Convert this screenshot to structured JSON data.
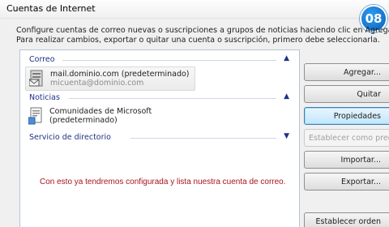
{
  "window": {
    "title": "Cuentas de Internet"
  },
  "badge": {
    "text": "08"
  },
  "instructions": {
    "line1": "Configure cuentas de correo nuevas o suscripciones a grupos de noticias haciendo clic en Agregar.",
    "line2": "Para realizar cambios, exportar o quitar una cuenta o suscripción, primero debe seleccionarla."
  },
  "groups": {
    "mail": {
      "label": "Correo",
      "account": {
        "name": "mail.dominio.com (predeterminado)",
        "email": "micuenta@dominio.com"
      }
    },
    "news": {
      "label": "Noticias",
      "account": {
        "name_line1": "Comunidades de Microsoft",
        "name_line2": "(predeterminado)"
      }
    },
    "directory": {
      "label": "Servicio de directorio"
    }
  },
  "caption": "Con esto ya tendremos configurada y lista nuestra cuenta de correo.",
  "buttons": {
    "add": "Agregar...",
    "remove": "Quitar",
    "properties": "Propiedades",
    "set_default": "Establecer como predet",
    "import": "Importar...",
    "export": "Exportar...",
    "set_order": "Establecer orden"
  },
  "icons": {
    "mail_account": "mail-server-icon",
    "news_account": "newsgroup-document-icon",
    "collapse": "chevron-up-icon",
    "expand": "chevron-down-icon"
  },
  "colors": {
    "group_header": "#1e3287",
    "caption": "#a8141e",
    "badge": "#1474d0"
  }
}
